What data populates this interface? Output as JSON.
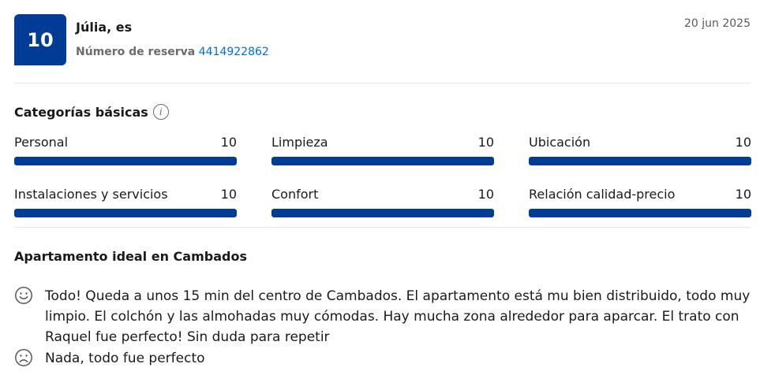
{
  "header": {
    "score": "10",
    "reviewer": "Júlia, es",
    "booking_label": "Número de reserva",
    "booking_number": "4414922862",
    "date": "20 jun 2025"
  },
  "categories": {
    "title": "Categorías básicas",
    "items": [
      {
        "label": "Personal",
        "score": "10",
        "fraction": 1.0
      },
      {
        "label": "Limpieza",
        "score": "10",
        "fraction": 1.0
      },
      {
        "label": "Ubicación",
        "score": "10",
        "fraction": 1.0
      },
      {
        "label": "Instalaciones y servicios",
        "score": "10",
        "fraction": 1.0
      },
      {
        "label": "Confort",
        "score": "10",
        "fraction": 1.0
      },
      {
        "label": "Relación calidad-precio",
        "score": "10",
        "fraction": 1.0
      }
    ]
  },
  "review": {
    "title": "Apartamento ideal en Cambados",
    "positive": "Todo! Queda a unos 15 min del centro de Cambados. El apartamento está mu bien distribuido, todo muy limpio. El colchón y las almohadas muy cómodas. Hay mucha zona alrededor para aparcar. El trato con Raquel fue perfecto! Sin duda para repetir",
    "negative": "Nada, todo fue perfecto",
    "positive_icon": "smile-face-icon",
    "negative_icon": "sad-face-icon"
  },
  "colors": {
    "brand": "#003b95",
    "link": "#006ce4"
  }
}
